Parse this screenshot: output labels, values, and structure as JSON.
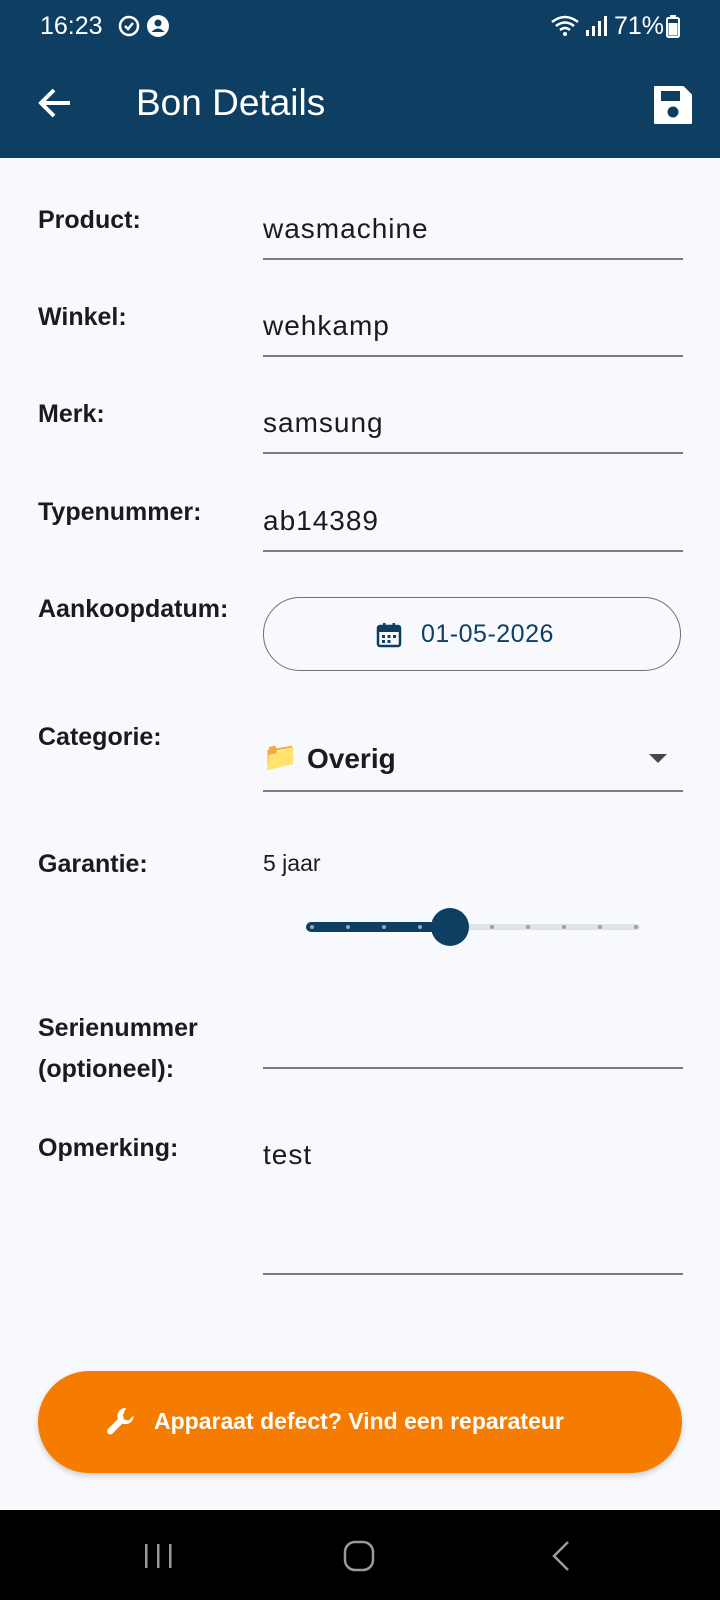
{
  "status": {
    "time": "16:23",
    "battery": "71%"
  },
  "header": {
    "title": "Bon Details"
  },
  "fields": {
    "product": {
      "label": "Product:",
      "value": "wasmachine"
    },
    "winkel": {
      "label": "Winkel:",
      "value": "wehkamp"
    },
    "merk": {
      "label": "Merk:",
      "value": "samsung"
    },
    "typenummer": {
      "label": "Typenummer:",
      "value": "ab14389"
    },
    "aankoopdatum": {
      "label": "Aankoopdatum:",
      "value": "01-05-2026"
    },
    "categorie": {
      "label": "Categorie:",
      "emoji": "📁",
      "value": "Overig"
    },
    "garantie": {
      "label": "Garantie:",
      "value": "5 jaar",
      "level": 5,
      "max": 10
    },
    "serienummer": {
      "label_line1": "Serienummer",
      "label_line2": "(optioneel):",
      "value": ""
    },
    "opmerking": {
      "label": "Opmerking:",
      "value": "test"
    }
  },
  "actions": {
    "repair_label": "Apparaat defect? Vind een reparateur"
  },
  "colors": {
    "primary": "#0e3f63",
    "accent": "#f57c00",
    "background": "#f7f9fd"
  },
  "icons": {
    "back": "arrow-left-icon",
    "save": "floppy-disk-icon",
    "calendar": "calendar-icon",
    "dropdown": "caret-down-icon",
    "repair": "wrench-icon"
  }
}
